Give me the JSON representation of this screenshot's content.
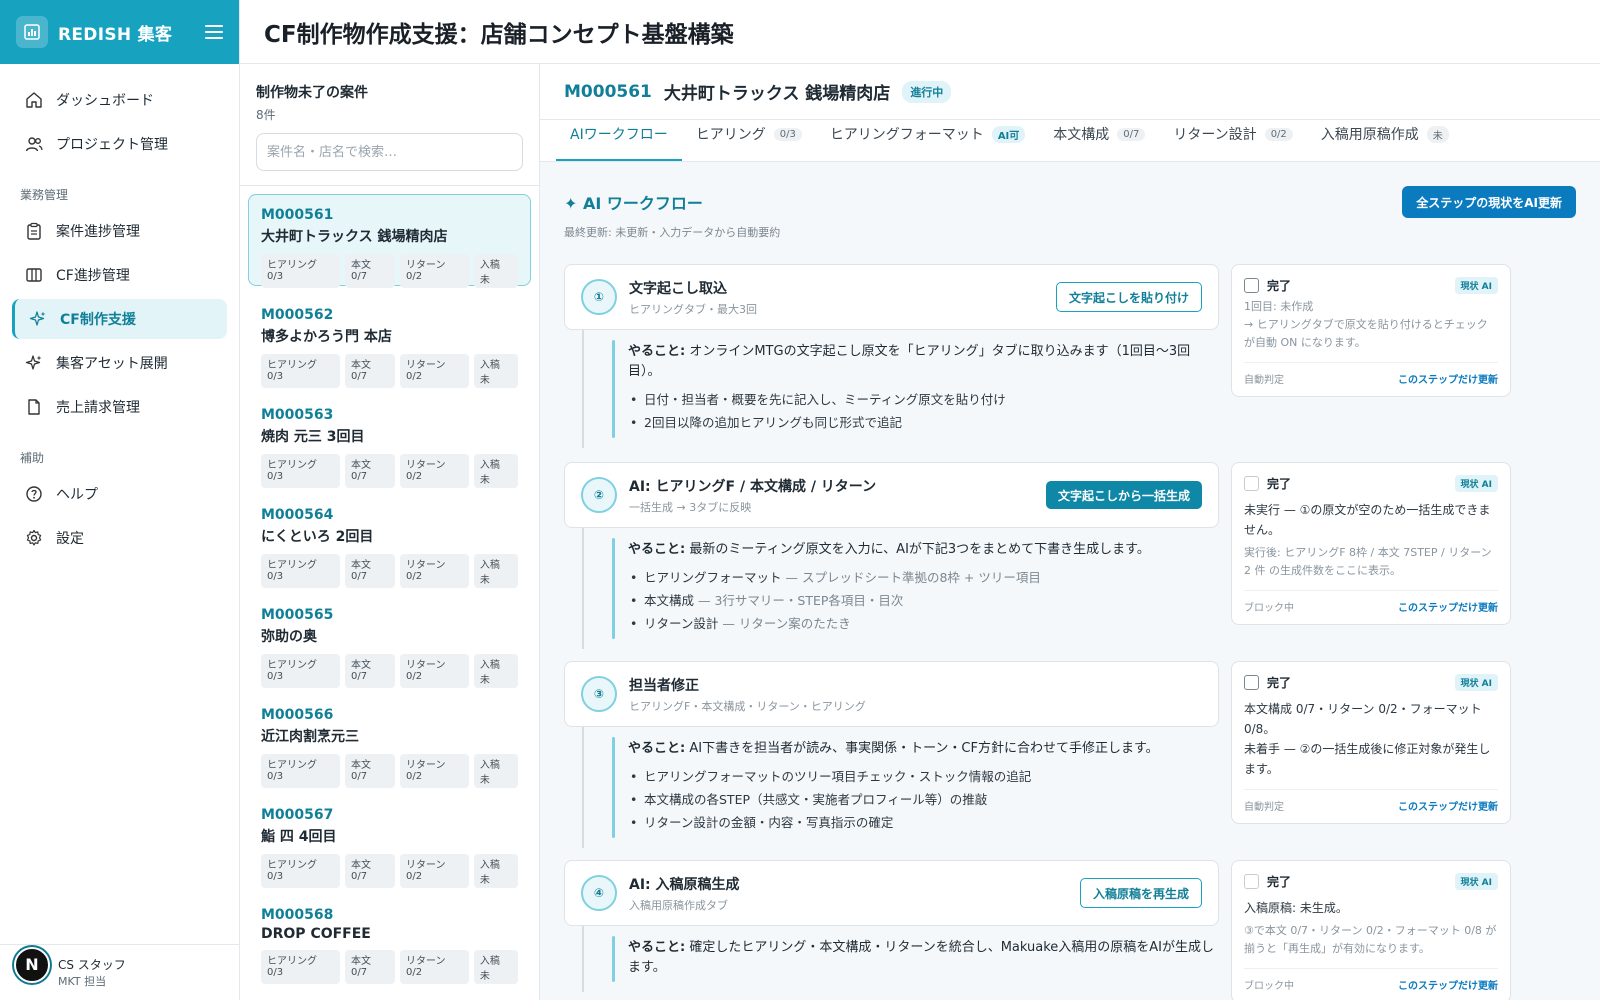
{
  "app": {
    "brand": "REDISH 集客"
  },
  "header": {
    "title": "CF制作物作成支援：店舗コンセプト基盤構築"
  },
  "sidebar": {
    "top_items": [
      {
        "label": "ダッシュボード",
        "icon": "home-icon"
      },
      {
        "label": "プロジェクト管理",
        "icon": "users-icon"
      }
    ],
    "section_business": "業務管理",
    "business_items": [
      {
        "label": "案件進捗管理",
        "icon": "clipboard-icon"
      },
      {
        "label": "CF進捗管理",
        "icon": "columns-icon"
      },
      {
        "label": "CF制作支援",
        "icon": "sparkles-icon",
        "active": true
      },
      {
        "label": "集客アセット展開",
        "icon": "sparkles-icon"
      },
      {
        "label": "売上請求管理",
        "icon": "file-icon"
      }
    ],
    "section_support": "補助",
    "support_items": [
      {
        "label": "ヘルプ",
        "icon": "help-icon"
      },
      {
        "label": "設定",
        "icon": "gear-icon"
      }
    ],
    "user": {
      "badge": "N",
      "name": "CS スタッフ",
      "role": "MKT 担当"
    }
  },
  "project_list": {
    "title": "制作物未了の案件",
    "count": "8件",
    "search_placeholder": "案件名・店名で検索…",
    "tags": [
      "ヒアリング 0/3",
      "本文 0/7",
      "リターン 0/2",
      "入稿 未"
    ],
    "items": [
      {
        "id": "M000561",
        "name": "大井町トラックス 銭場精肉店"
      },
      {
        "id": "M000562",
        "name": "博多よかろう門 本店"
      },
      {
        "id": "M000563",
        "name": "焼肉 元三 3回目"
      },
      {
        "id": "M000564",
        "name": "にくといろ 2回目"
      },
      {
        "id": "M000565",
        "name": "弥助の奥"
      },
      {
        "id": "M000566",
        "name": "近江肉割烹元三"
      },
      {
        "id": "M000567",
        "name": "鮨 四 4回目"
      },
      {
        "id": "M000568",
        "name": "DROP COFFEE"
      }
    ]
  },
  "detail": {
    "id": "M000561",
    "name": "大井町トラックス 銭場精肉店",
    "status": "進行中",
    "tabs": [
      {
        "label": "AIワークフロー",
        "badge": ""
      },
      {
        "label": "ヒアリング",
        "badge": "0/3"
      },
      {
        "label": "ヒアリングフォーマット",
        "badge": "AI可"
      },
      {
        "label": "本文構成",
        "badge": "0/7"
      },
      {
        "label": "リターン設計",
        "badge": "0/2"
      },
      {
        "label": "入稿用原稿作成",
        "badge": "未"
      }
    ],
    "workflow": {
      "title": "✦ AI ワークフロー",
      "update_all": "全ステップの現状をAI更新",
      "last_updated": "最終更新: 未更新・入力データから自動要約",
      "todo_prefix": "やること:",
      "done_label": "完了",
      "ai_badge": "現状 AI",
      "update_step": "このステップだけ更新",
      "steps": [
        {
          "num": "①",
          "title": "文字起こし取込",
          "sub": "ヒアリングタブ・最大3回",
          "button": "文字起こしを貼り付け",
          "todo": "オンラインMTGの文字起こし原文を「ヒアリング」タブに取り込みます（1回目〜3回目）。",
          "bullets": [
            "日付・担当者・概要を先に記入し、ミーティング原文を貼り付け",
            "2回目以降の追加ヒアリングも同じ形式で追記"
          ],
          "check_main": "",
          "check_sub": "1回目: 未作成\n→ ヒアリングタブで原文を貼り付けるとチェックが自動 ON になります。",
          "state": "自動判定"
        },
        {
          "num": "②",
          "title": "AI: ヒアリングF / 本文構成 / リターン",
          "sub": "一括生成 → 3タブに反映",
          "button": "文字起こしから一括生成",
          "todo": "最新のミーティング原文を入力に、AIが下記3つをまとめて下書き生成します。",
          "bullets": [
            "ヒアリングフォーマット",
            "本文構成",
            "リターン設計"
          ],
          "bullet_notes": [
            " — スプレッドシート準拠の8枠 + ツリー項目",
            " — 3行サマリー・STEP各項目・目次",
            " — リターン案のたたき"
          ],
          "check_main": "未実行 — ①の原文が空のため一括生成できません。",
          "check_sub": "実行後: ヒアリングF 8枠 / 本文 7STEP / リターン 2 件 の生成件数をここに表示。",
          "state": "ブロック中"
        },
        {
          "num": "③",
          "title": "担当者修正",
          "sub": "ヒアリングF・本文構成・リターン・ヒアリング",
          "button": "",
          "todo": "AI下書きを担当者が読み、事実関係・トーン・CF方針に合わせて手修正します。",
          "bullets": [
            "ヒアリングフォーマットのツリー項目チェック・ストック情報の追記",
            "本文構成の各STEP（共感文・実施者プロフィール等）の推敲",
            "リターン設計の金額・内容・写真指示の確定"
          ],
          "check_main": "本文構成 0/7・リターン 0/2・フォーマット 0/8。\n未着手 — ②の一括生成後に修正対象が発生します。",
          "check_sub": "",
          "state": "自動判定"
        },
        {
          "num": "④",
          "title": "AI: 入稿原稿生成",
          "sub": "入稿用原稿作成タブ",
          "button": "入稿原稿を再生成",
          "todo": "確定したヒアリング・本文構成・リターンを統合し、Makuake入稿用の原稿をAIが生成します。",
          "bullets": [],
          "check_main": "入稿原稿: 未生成。",
          "check_sub": "③で本文 0/7・リターン 0/2・フォーマット 0/8 が揃うと「再生成」が有効になります。",
          "state": "ブロック中"
        }
      ]
    }
  }
}
